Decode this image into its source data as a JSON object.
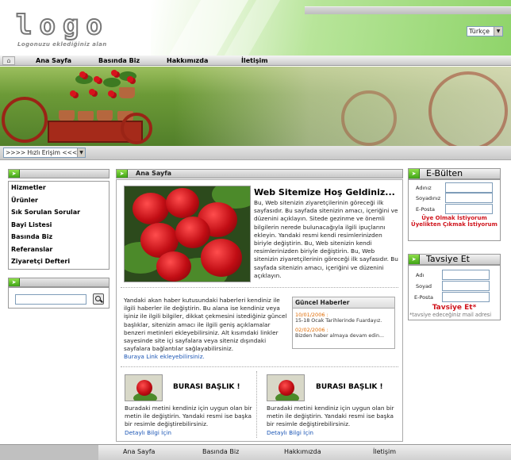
{
  "header": {
    "logo": "logo",
    "logo_sub": "Logonuzu eklediğiniz alan",
    "language": "Türkçe"
  },
  "nav": {
    "items": [
      "Ana Sayfa",
      "Basında Biz",
      "Hakkımızda",
      "İletişim"
    ]
  },
  "quick_access": {
    "label": ">>>> Hızlı Erişim <<<<"
  },
  "sidebar": {
    "items": [
      "Hizmetler",
      "Ürünler",
      "Sık Sorulan Sorular",
      "Bayi Listesi",
      "Basında Biz",
      "Referanslar",
      "Ziyaretçi Defteri"
    ]
  },
  "main": {
    "header": "Ana Sayfa",
    "welcome_title": "Web Sitemize Hoş Geldiniz...",
    "welcome_text": "Bu, Web sitenizin ziyaretçilerinin göreceği ilk sayfasıdır. Bu sayfada sitenizin amacı, içeriğini ve düzenini açıklayın. Sitede gezinme ve önemli bilgilerin nerede bulunacağıyla ilgili ipuçlarını ekleyin. Yandaki resmi kendi resimlerinizden biriyle değiştirin. Bu, Web sitenizin kendi resimlerinizden biriyle değiştirin. Bu, Web sitenizin ziyaretçilerinin göreceği ilk sayfasıdır. Bu sayfada sitenizin amacı, içeriğini ve düzenini açıklayın.",
    "mid_text": "Yandaki akan haber kutusundaki haberleri kendiniz ile ilgili haberler ile değiştirin. Bu alana ise kendiniz veya işiniz ile ilgili bilgiler, dikkat çekmesini istediğiniz güncel başlıklar, sitenizin amacı ile ilgili geniş açıklamalar benzeri metinleri ekleyebilirsiniz. Alt kısımdaki linkler sayesinde site içi sayfalara veya siteniz dışındaki sayfalara bağlantılar sağlayabilirsiniz.",
    "mid_link": "Buraya Link ekleyebilirsiniz.",
    "news": {
      "title": "Güncel Haberler",
      "items": [
        {
          "date": "10/01/2006 :",
          "text": "15-18 Ocak Tarihlerinde Fuardayız."
        },
        {
          "date": "02/02/2006 :",
          "text": "Bizden haber almaya devam edin..."
        }
      ]
    },
    "cards": [
      {
        "title": "BURASI BAŞLIK !",
        "text": "Buradaki metini kendiniz için uygun olan bir metin ile değiştirin. Yandaki resmi ise başka bir resimle değiştirebilirsiniz.",
        "link": "Detaylı Bilgi İçin"
      },
      {
        "title": "BURASI BAŞLIK !",
        "text": "Buradaki metini kendiniz için uygun olan bir metin ile değiştirin. Yandaki resmi ise başka bir resimle değiştirebilirsiniz.",
        "link": "Detaylı Bilgi İçin"
      }
    ]
  },
  "ebulten": {
    "title": "E-Bülten",
    "labels": [
      "Adınız",
      "Soyadınız",
      "E-Posta"
    ],
    "subscribe": "Üye Olmak İstiyorum",
    "unsubscribe": "Üyelikten Çıkmak İstiyorum"
  },
  "tavsiye": {
    "title": "Tavsiye Et",
    "labels": [
      "Adı",
      "Soyad",
      "E-Posta"
    ],
    "button": "Tavsiye Et*",
    "note": "*tavsiye edeceğiniz mail adresi"
  },
  "footer": {
    "items": [
      "Ana Sayfa",
      "Basında Biz",
      "Hakkımızda",
      "İletişim"
    ]
  },
  "colors": {
    "accent_green": "#3fa316",
    "red": "#d0151d",
    "link_blue": "#1a55b5",
    "news_date": "#e06a00"
  }
}
